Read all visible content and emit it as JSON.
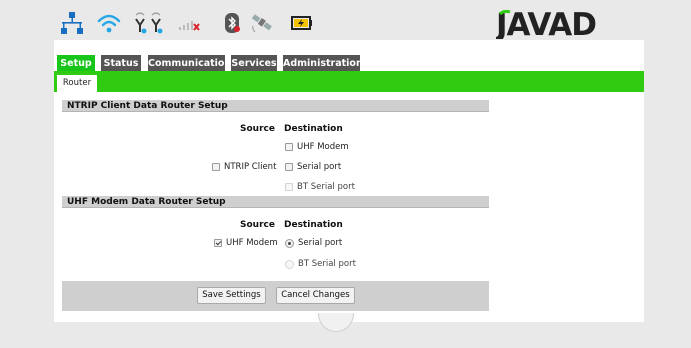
{
  "status_icons": {
    "network": "network-icon",
    "wifi": "wifi-icon",
    "radio": "radio-antennas-icon",
    "signal": "signal-bars-no-service-icon",
    "bluetooth": "bluetooth-icon",
    "satellite": "satellite-icon",
    "battery": "battery-charging-icon"
  },
  "logo": {
    "text": "JAVAD"
  },
  "tabs": [
    {
      "label": "Setup"
    },
    {
      "label": "Status"
    },
    {
      "label": "Communication"
    },
    {
      "label": "Services"
    },
    {
      "label": "Administration"
    }
  ],
  "subtabs": [
    {
      "label": "Router"
    }
  ],
  "ntrip_section": {
    "title": "NTRIP Client Data Router Setup",
    "source_header": "Source",
    "destination_header": "Destination",
    "source": {
      "label": "NTRIP Client",
      "checked": false
    },
    "destinations": [
      {
        "label": "UHF Modem",
        "checked": false,
        "disabled": false
      },
      {
        "label": "Serial port",
        "checked": false,
        "disabled": false
      },
      {
        "label": "BT Serial port",
        "checked": false,
        "disabled": true
      }
    ]
  },
  "uhf_section": {
    "title": "UHF Modem Data Router Setup",
    "source_header": "Source",
    "destination_header": "Destination",
    "source": {
      "label": "UHF Modem",
      "checked": true
    },
    "destinations": [
      {
        "label": "Serial port",
        "selected": true,
        "disabled": false
      },
      {
        "label": "BT Serial port",
        "selected": false,
        "disabled": true
      }
    ]
  },
  "buttons": {
    "save": "Save Settings",
    "cancel": "Cancel Changes"
  },
  "colors": {
    "accent_green": "#2fcc12",
    "tab_dark": "#555555",
    "section_gray": "#cfcfcf"
  }
}
